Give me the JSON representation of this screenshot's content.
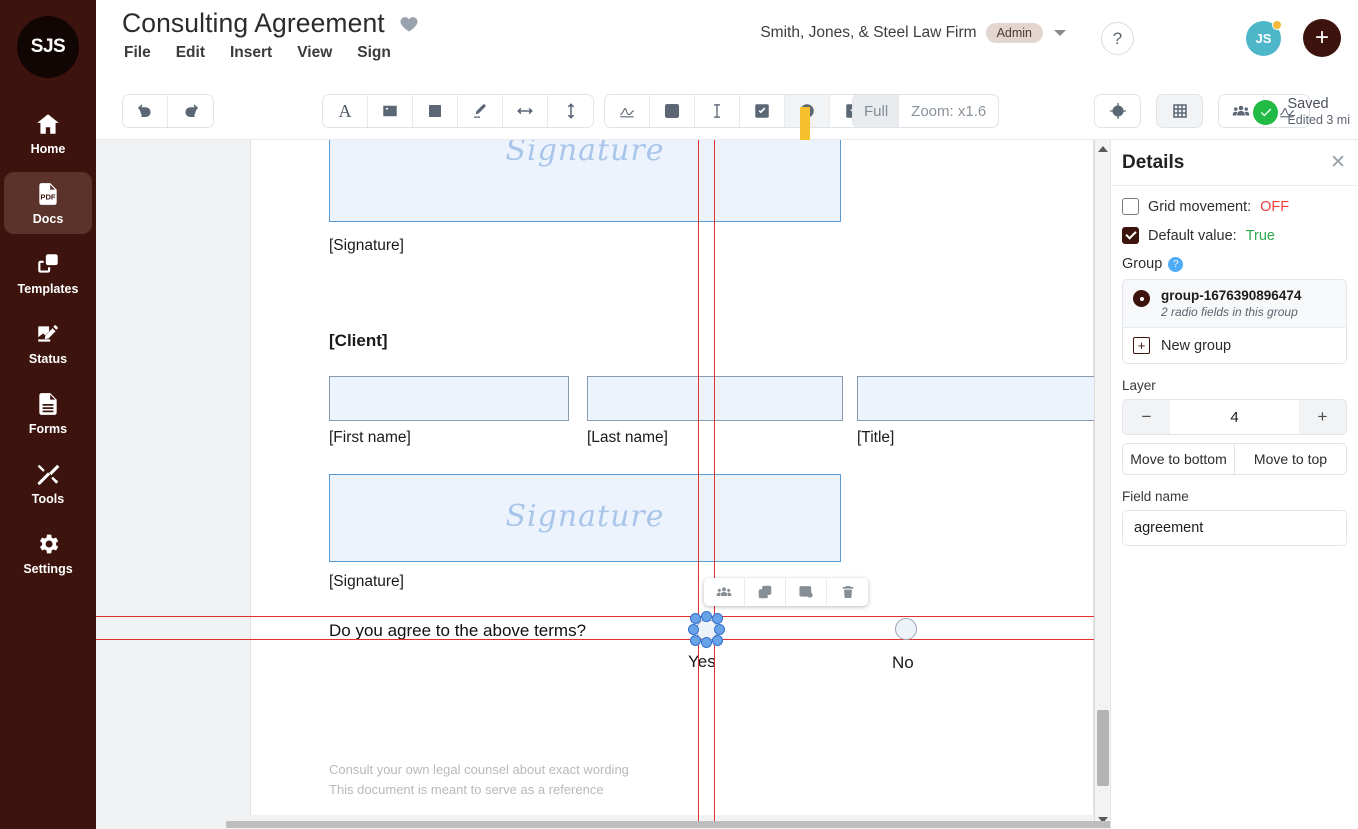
{
  "brand": {
    "logo_text": "SJS"
  },
  "sidebar": {
    "items": [
      {
        "label": "Home",
        "icon": "home-icon"
      },
      {
        "label": "Docs",
        "icon": "pdf-document-icon"
      },
      {
        "label": "Templates",
        "icon": "copy-layers-icon"
      },
      {
        "label": "Status",
        "icon": "signing-hand-icon"
      },
      {
        "label": "Forms",
        "icon": "form-lines-icon"
      },
      {
        "label": "Tools",
        "icon": "wrench-screwdriver-icon"
      },
      {
        "label": "Settings",
        "icon": "gear-icon"
      }
    ],
    "active": "Docs",
    "filmstrip_tab_icon": "filmstrip-icon"
  },
  "header": {
    "title": "Consulting Agreement",
    "favorite_icon": "heart-icon",
    "menus": [
      "File",
      "Edit",
      "Insert",
      "View",
      "Sign"
    ],
    "org_name": "Smith, Jones, & Steel Law Firm",
    "org_role_badge": "Admin",
    "org_caret_icon": "chevron-down-icon",
    "help_label": "?",
    "avatar_initials": "JS",
    "avatar_accent": "#4db6c9",
    "notification_dot_color": "#f6b93b",
    "add_button_label": "+"
  },
  "toolbar": {
    "history": [
      {
        "name": "undo-icon"
      },
      {
        "name": "redo-icon"
      }
    ],
    "insert": [
      {
        "name": "text-icon",
        "glyph": "A"
      },
      {
        "name": "image-icon"
      },
      {
        "name": "shape-square-icon"
      },
      {
        "name": "highlighter-pen-icon"
      },
      {
        "name": "arrow-horizontal-icon"
      },
      {
        "name": "arrow-vertical-icon"
      }
    ],
    "fields": [
      {
        "name": "signature-field-icon"
      },
      {
        "name": "initials-field-icon"
      },
      {
        "name": "text-field-icon"
      },
      {
        "name": "checkbox-field-icon"
      },
      {
        "name": "radio-field-icon",
        "active": true
      },
      {
        "name": "dropdown-field-icon"
      }
    ],
    "media": [
      {
        "name": "stamp-image-icon"
      }
    ],
    "zoom": {
      "full_label": "Full",
      "value_label": "Zoom: x1.6"
    },
    "locate": [
      {
        "name": "target-locate-icon"
      }
    ],
    "grid": [
      {
        "name": "grid-icon"
      }
    ],
    "share": [
      {
        "name": "recipients-icon"
      },
      {
        "name": "sign-request-icon"
      }
    ],
    "status": {
      "saved_label": "Saved",
      "edited_label": "Edited 3 mi"
    },
    "pointer_hint_color": "#f5c02b"
  },
  "document": {
    "signature_placeholder": "Signature",
    "blocks": [
      {
        "type": "signature-caption",
        "label": "[Signature]"
      },
      {
        "type": "section-heading",
        "label": "[Client]"
      },
      {
        "type": "field-caption",
        "label": "[First name]"
      },
      {
        "type": "field-caption",
        "label": "[Last name]"
      },
      {
        "type": "field-caption",
        "label": "[Title]"
      },
      {
        "type": "signature-caption",
        "label": "[Signature]"
      }
    ],
    "question": "Do you agree to the above terms?",
    "radio_options": [
      {
        "label": "Yes",
        "selected": true
      },
      {
        "label": "No",
        "selected": false
      }
    ],
    "footer_lines": [
      "Consult your own legal counsel about exact wording",
      "This document is meant to serve as a reference"
    ],
    "guide_color": "#e03131",
    "selection_handle_color": "#6ba3e8"
  },
  "field_toolbar": [
    {
      "name": "assign-recipient-icon"
    },
    {
      "name": "duplicate-icon"
    },
    {
      "name": "field-settings-icon"
    },
    {
      "name": "delete-icon"
    }
  ],
  "details": {
    "title": "Details",
    "close_icon": "close-icon",
    "grid_movement": {
      "label": "Grid movement:",
      "value": "OFF",
      "checked": false
    },
    "default_value": {
      "label": "Default value:",
      "value": "True",
      "checked": true
    },
    "group_section": {
      "title": "Group",
      "help_icon": "question-help-icon",
      "selected_group": {
        "name": "group-1676390896474",
        "subtitle": "2 radio fields in this group"
      },
      "new_group_label": "New group",
      "new_group_icon": "plus-square-icon"
    },
    "layer": {
      "label": "Layer",
      "value": "4",
      "decrement_label": "−",
      "increment_label": "+",
      "move_bottom_label": "Move to bottom",
      "move_top_label": "Move to top"
    },
    "field_name": {
      "label": "Field name",
      "value": "agreement"
    }
  }
}
